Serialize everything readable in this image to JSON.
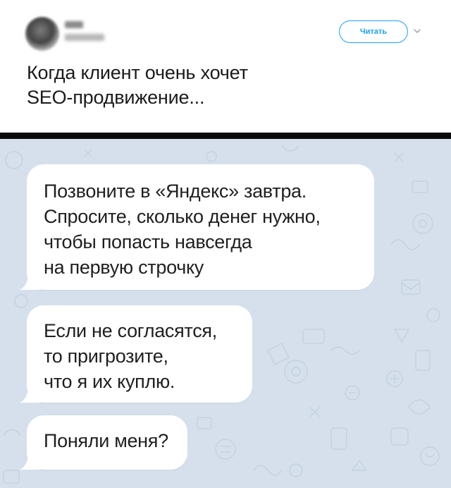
{
  "tweet": {
    "follow_label": "Читать",
    "text_lines": [
      "Когда клиент очень хочет",
      "SEO-продвижение..."
    ],
    "icons": {
      "avatar": "avatar",
      "menu": "chevron-down-icon"
    }
  },
  "chat": {
    "messages": [
      {
        "lines": [
          "Позвоните в «Яндекс» завтра.",
          "Спросите, сколько денег нужно,",
          "чтобы попасть навсегда",
          "на первую строчку"
        ]
      },
      {
        "lines": [
          "Если не согласятся,",
          "то пригрозите,",
          "что я их куплю."
        ]
      },
      {
        "lines": [
          "Поняли меня?"
        ]
      }
    ]
  },
  "colors": {
    "twitter_blue": "#1da1f2",
    "chat_background": "#d5e0ec",
    "bubble": "#ffffff",
    "divider": "#0a0a0a"
  }
}
